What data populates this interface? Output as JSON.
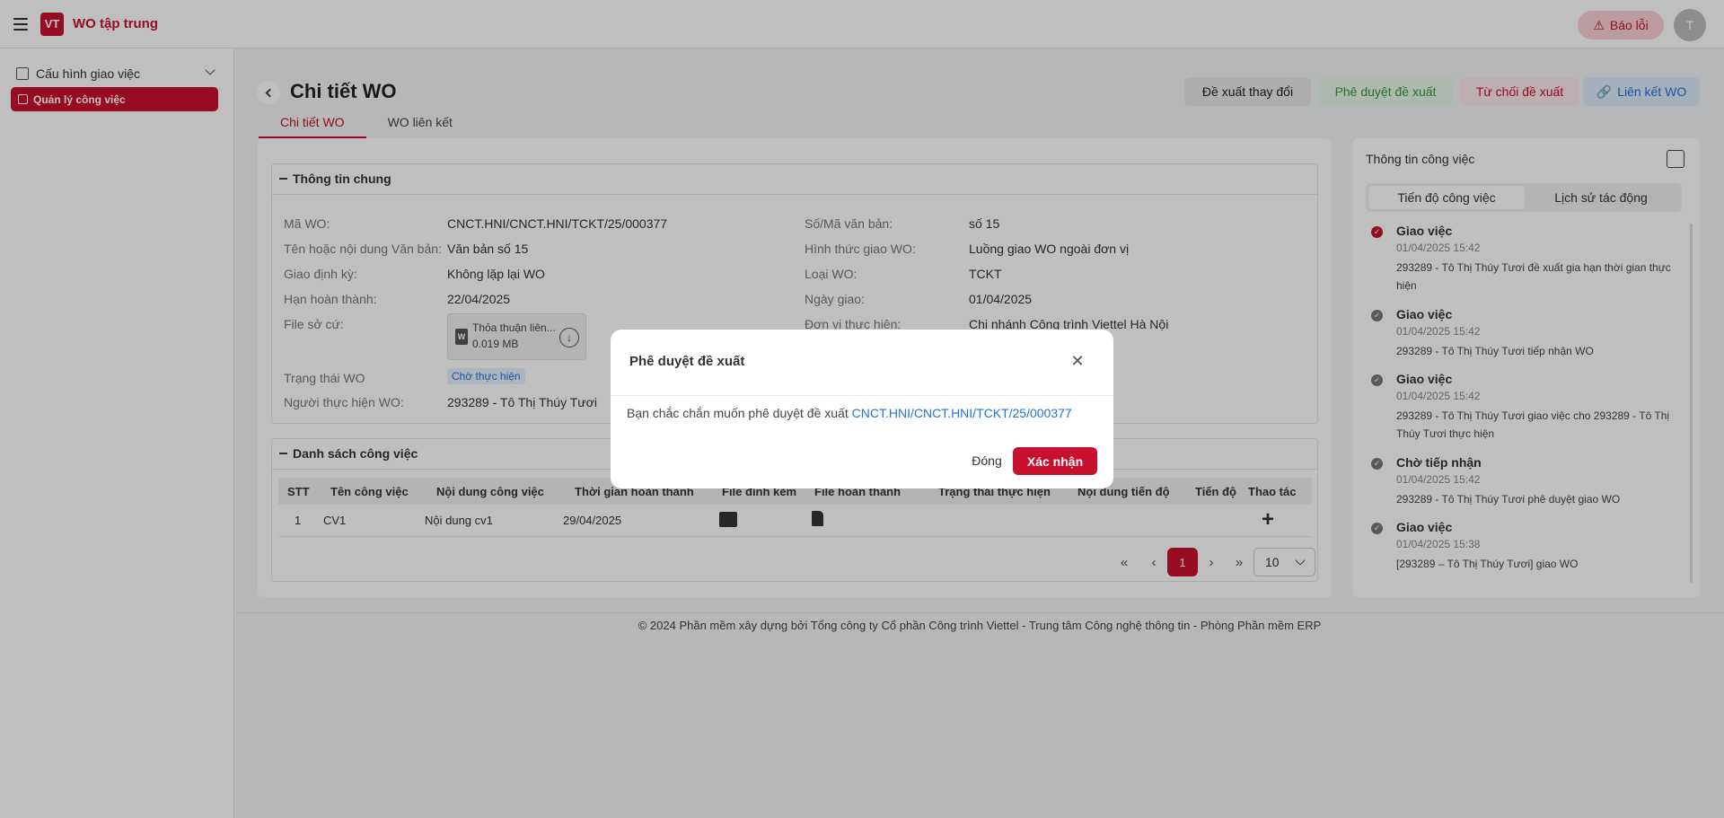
{
  "header": {
    "app_title": "WO tập trung",
    "logo_text": "VT",
    "report_label": "Báo lỗi",
    "avatar_initial": "T"
  },
  "sidebar": {
    "group_label": "Cấu hình giao việc",
    "active_item": "Quản lý công việc"
  },
  "page": {
    "title": "Chi tiết WO",
    "tabs": [
      "Chi tiết WO",
      "WO liên kết"
    ],
    "actions": {
      "propose_change": "Đề xuất thay đổi",
      "approve": "Phê duyệt đề xuất",
      "reject": "Từ chối đề xuất",
      "link": "Liên kết WO"
    }
  },
  "general": {
    "section_title": "Thông tin chung",
    "left": [
      {
        "label": "Mã WO:",
        "value": "CNCT.HNI/CNCT.HNI/TCKT/25/000377"
      },
      {
        "label": "Tên hoặc nội dung Văn bản:",
        "value": "Văn bản số 15"
      },
      {
        "label": "Giao định kỳ:",
        "value": "Không lặp lại WO"
      },
      {
        "label": "Hạn hoàn thành:",
        "value": "22/04/2025"
      },
      {
        "label": "File sở cứ:",
        "value": ""
      },
      {
        "label": "Trạng thái WO",
        "value": ""
      },
      {
        "label": "Người thực hiện WO:",
        "value": "293289 - Tô Thị Thúy Tươi"
      }
    ],
    "right": [
      {
        "label": "Số/Mã văn bản:",
        "value": "số 15"
      },
      {
        "label": "Hình thức giao WO:",
        "value": "Luồng giao WO ngoài đơn vị"
      },
      {
        "label": "Loại WO:",
        "value": "TCKT"
      },
      {
        "label": "Ngày giao:",
        "value": "01/04/2025"
      },
      {
        "label": "Đơn vị thực hiện:",
        "value": "Chi nhánh Công trình Viettel Hà Nội"
      }
    ],
    "file": {
      "name": "Thỏa thuận liên...",
      "size": "0.019 MB",
      "type_letter": "W"
    },
    "status_badge": "Chờ thực hiện"
  },
  "tasks": {
    "section_title": "Danh sách công việc",
    "columns": [
      "STT",
      "Tên công việc",
      "Nội dung công việc",
      "Thời gian hoàn thành",
      "File đính kèm",
      "File hoàn thành",
      "Trạng thái thực hiện",
      "Nội dung tiến độ",
      "Tiến độ",
      "Thao tác"
    ],
    "rows": [
      {
        "stt": "1",
        "name": "CV1",
        "content": "Nội dung cv1",
        "deadline": "29/04/2025"
      }
    ],
    "pager": {
      "first": "«",
      "prev": "‹",
      "current": "1",
      "next": "›",
      "last": "»",
      "page_size": "10"
    }
  },
  "right_panel": {
    "title": "Thông tin công việc",
    "tabs": [
      "Tiến độ công việc",
      "Lịch sử tác động"
    ],
    "timeline": [
      {
        "title": "Giao việc",
        "time": "01/04/2025 15:42",
        "desc": "293289 - Tô Thị Thúy Tươi đề xuất gia hạn thời gian thực hiện"
      },
      {
        "title": "Giao việc",
        "time": "01/04/2025 15:42",
        "desc": "293289 - Tô Thị Thúy Tươi tiếp nhận WO"
      },
      {
        "title": "Giao việc",
        "time": "01/04/2025 15:42",
        "desc": "293289 - Tô Thị Thúy Tươi giao việc cho 293289 - Tô Thị Thúy Tươi thực hiện"
      },
      {
        "title": "Chờ tiếp nhận",
        "time": "01/04/2025 15:42",
        "desc": "293289 - Tô Thị Thúy Tươi phê duyệt giao WO"
      },
      {
        "title": "Giao việc",
        "time": "01/04/2025 15:38",
        "desc": "[293289 – Tô Thị Thúy Tươi] giao WO"
      }
    ]
  },
  "footer": {
    "text": "© 2024 Phần mềm xây dựng bởi Tổng công ty Cổ phần Công trình Viettel - Trung tâm Công nghệ thông tin - Phòng Phần mềm ERP"
  },
  "modal": {
    "title": "Phê duyệt đề xuất",
    "close_glyph": "✕",
    "message": "Bạn chắc chắn muốn phê duyệt đề xuất",
    "wo_code": "CNCT.HNI/CNCT.HNI/TCKT/25/000377",
    "cancel_label": "Đóng",
    "confirm_label": "Xác nhận"
  },
  "colors": {
    "brand": "#c8102e",
    "link": "#1e73d8",
    "success": "#2e9a3b"
  }
}
